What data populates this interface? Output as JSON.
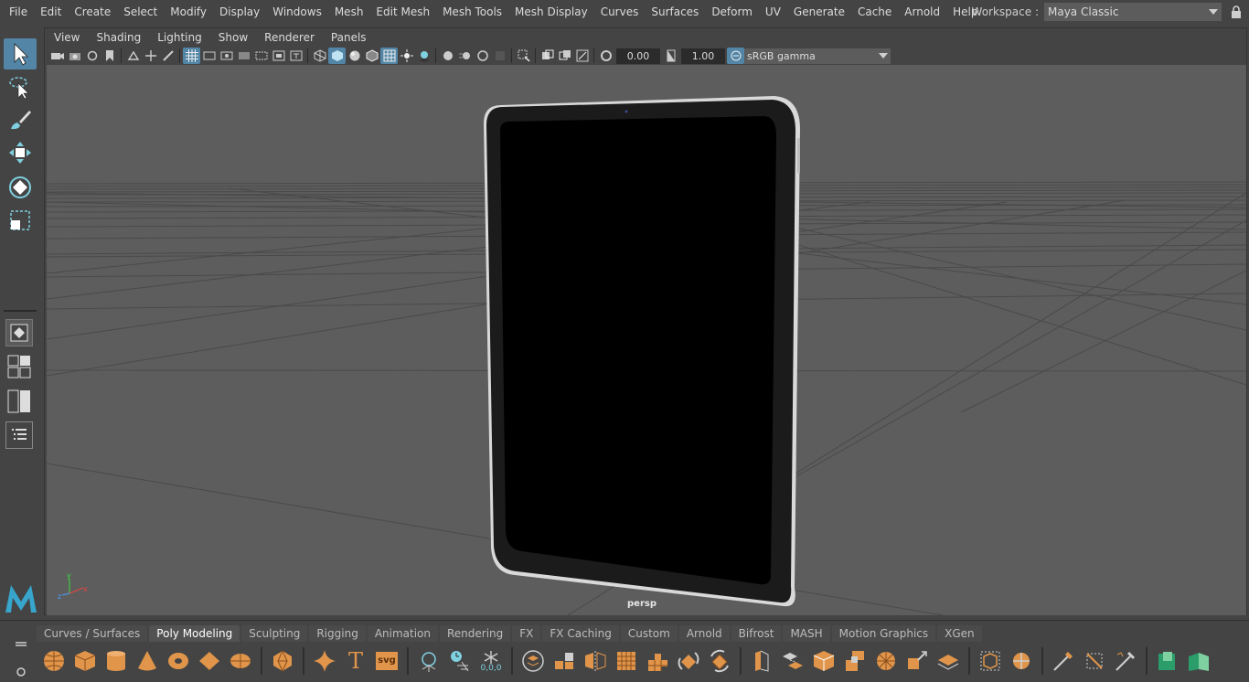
{
  "menubar": {
    "items": [
      "File",
      "Edit",
      "Create",
      "Select",
      "Modify",
      "Display",
      "Windows",
      "Mesh",
      "Edit Mesh",
      "Mesh Tools",
      "Mesh Display",
      "Curves",
      "Surfaces",
      "Deform",
      "UV",
      "Generate",
      "Cache",
      "Arnold",
      "Help"
    ]
  },
  "workspace": {
    "label": "Workspace :",
    "value": "Maya Classic"
  },
  "toolbox": {
    "tools": [
      "select-tool-icon",
      "lasso-tool-icon",
      "paint-select-tool-icon",
      "move-tool-icon",
      "rotate-tool-icon",
      "scale-tool-icon"
    ],
    "layouts": [
      "single-pane-layout-icon",
      "four-pane-layout-icon",
      "two-pane-layout-icon",
      "outliner-layout-icon"
    ]
  },
  "panel": {
    "menu": [
      "View",
      "Shading",
      "Lighting",
      "Show",
      "Renderer",
      "Panels"
    ],
    "exposure": "0.00",
    "gamma": "1.00",
    "color_space": "sRGB gamma",
    "camera_label": "persp"
  },
  "shelf": {
    "tabs": [
      "Curves / Surfaces",
      "Poly Modeling",
      "Sculpting",
      "Rigging",
      "Animation",
      "Rendering",
      "FX",
      "FX Caching",
      "Custom",
      "Arnold",
      "Bifrost",
      "MASH",
      "Motion Graphics",
      "XGen"
    ],
    "active_tab": "Poly Modeling",
    "icon_text": {
      "svg": "svg",
      "type": "T",
      "origin": "0,0,0"
    }
  },
  "colors": {
    "accent": "#5285a6",
    "shelf_orange": "#e0954a",
    "viewport_bg": "#5d5d5d"
  }
}
